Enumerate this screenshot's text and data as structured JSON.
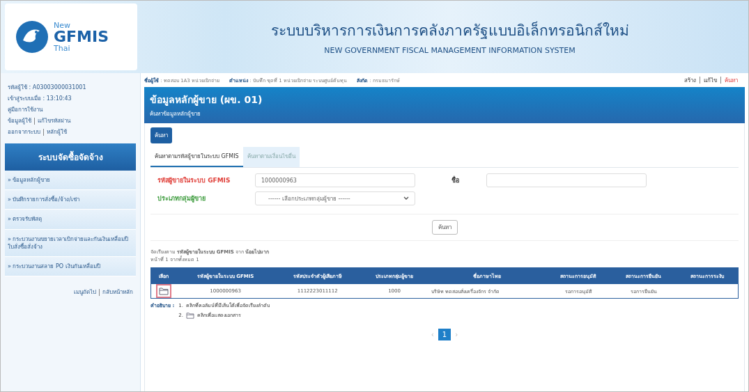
{
  "header": {
    "logo_top": "New",
    "logo_main": "GFMIS",
    "logo_bottom": "Thai",
    "title_th": "ระบบบริหารการเงินการคลังภาครัฐแบบอิเล็กทรอนิกส์ใหม่",
    "title_en": "NEW GOVERNMENT FISCAL MANAGEMENT INFORMATION SYSTEM"
  },
  "sidebar": {
    "user_id": "รหัสผู้ใช้ : A03003000031001",
    "login_time": "เข้าสู่ระบบเมื่อ : 13:10:43",
    "manual": "คู่มือการใช้งาน",
    "link_rows": [
      [
        "ข้อมูลผู้ใช้",
        "แก้ไขรหัสผ่าน"
      ],
      [
        "ออกจากระบบ",
        "หลักผู้ใช้"
      ]
    ],
    "menu_title": "ระบบจัดซื้อจัดจ้าง",
    "menu_items": [
      "» ข้อมูลหลักผู้ขาย",
      "» บันทึกรายการสั่งซื้อ/จ้าง/เช่า",
      "» ตรวจรับพัสดุ",
      "» กระบวนงานขยายเวลาเบิกจ่ายและกันเงินเหลื่อมปี ใบสั่งซื้อสั่งจ้าง",
      "» กระบวนงานสลาย PO เงินกันเหลื่อมปี"
    ],
    "footer_links": [
      "เมนูถัดไป",
      "กลับหน้าหลัก"
    ]
  },
  "info_bar": {
    "fields": [
      {
        "label": "ชื่อผู้ใช้",
        "value": ": ทดสอบ 1A3 หน่วยเบิกจ่าย"
      },
      {
        "label": "ตำแหน่ง",
        "value": ": บันทึก ชุดที่ 1 หน่วยเบิกจ่าย ระบบศูนย์ต้นทุน"
      },
      {
        "label": "สังกัด",
        "value": ": กรมธนารักษ์"
      }
    ],
    "actions": [
      {
        "label": "สร้าง",
        "selected": false
      },
      {
        "label": "แก้ไข",
        "selected": false
      },
      {
        "label": "ค้นหา",
        "selected": true
      }
    ]
  },
  "page": {
    "title": "ข้อมูลหลักผู้ขาย (ผข. 01)",
    "subtitle": "ค้นหาข้อมูลหลักผู้ขาย",
    "mode_button": "ค้นหา",
    "tabs": [
      {
        "label": "ค้นหาตามรหัสผู้ขายในระบบ GFMIS",
        "selected": true
      },
      {
        "label": "ค้นหาตามเงื่อนไขอื่น",
        "selected": false
      }
    ],
    "fields": [
      {
        "kind": "text",
        "label": "รหัสผู้ขายในระบบ GFMIS",
        "color": "#e0403a",
        "value": "1000000963"
      },
      {
        "kind": "text",
        "label": "ชื่อ",
        "color": "#333333"
      },
      {
        "kind": "select",
        "label": "ประเภทกลุ่มผู้ขาย",
        "color": "#3a9a3a",
        "placeholder": "------ เลือกประเภทกลุ่มผู้ขาย ------"
      }
    ],
    "search_button": "ค้นหา",
    "sort_note": "จัดเรียงตาม **รหัสผู้ขายในระบบ GFMIS** จาก **น้อยไปมาก**",
    "page_note": "หน้าที่ 1 จากทั้งหมด 1"
  },
  "table": {
    "columns": [
      "เลือก",
      "รหัสผู้ขายในระบบ GFMIS",
      "รหัสประจำตัวผู้เสียภาษี",
      "ประเภทกลุ่มผู้ขาย",
      "ชื่อภาษาไทย",
      "สถานะการอนุมัติ",
      "สถานะการยืนยัน",
      "สถานะการระงับ"
    ],
    "rows": [
      {
        "cells": [
          "",
          "1000000963",
          "1112223011112",
          "1000",
          "บริษัท ทดสอบสั่งเครื่องจักร จำกัด",
          "รอการอนุมัติ",
          "รอการยืนยัน",
          ""
        ]
      }
    ]
  },
  "legend": {
    "title": "คำอธิบาย :",
    "items": [
      {
        "kind": "text",
        "number": "1.",
        "text": "คลิกที่คอลัมน์ที่มีเส้นใต้เพื่อจัดเรียงลำดับ"
      },
      {
        "kind": "icon",
        "number": "2.",
        "text": "คลิกเพื่อแสดงเอกสาร"
      }
    ]
  },
  "pagination": {
    "prev": "‹",
    "pages": [
      {
        "label": "1",
        "selected": true
      }
    ],
    "next": "›"
  }
}
